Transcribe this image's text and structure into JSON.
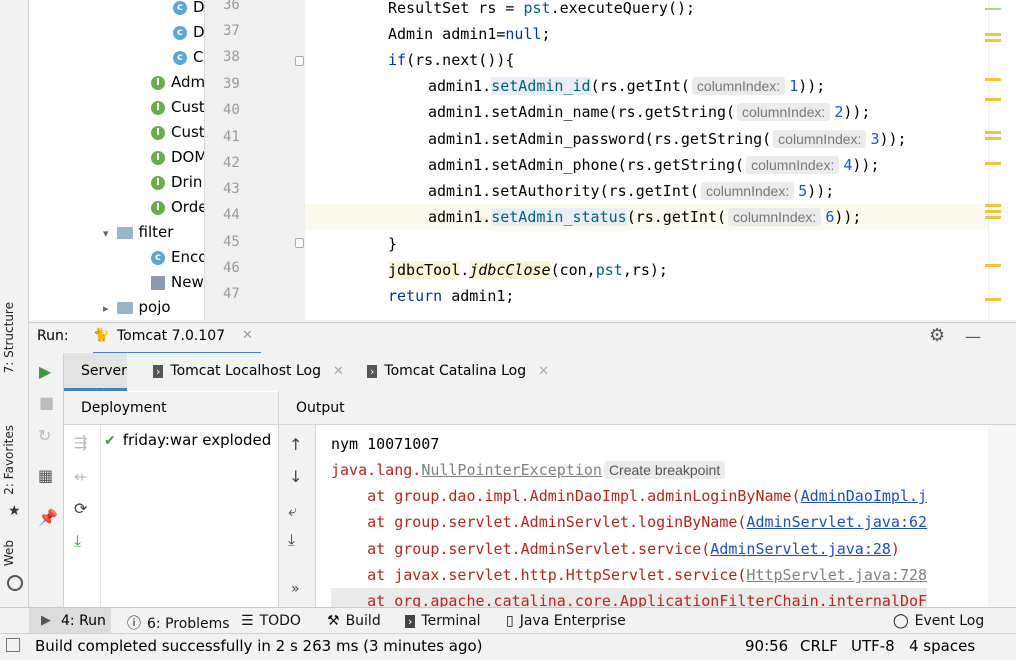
{
  "left_strip": {
    "structure": "7: Structure",
    "favorites": "2: Favorites",
    "web": "Web"
  },
  "tree": {
    "items": [
      "D",
      "D",
      "C",
      "Adm",
      "Cust",
      "Cust",
      "DOM",
      "Drin",
      "Orde",
      "filter",
      "Enco",
      "New",
      "pojo"
    ]
  },
  "editor": {
    "line_numbers": [
      "36",
      "37",
      "38",
      "39",
      "40",
      "41",
      "42",
      "43",
      "44",
      "45",
      "46",
      "47"
    ],
    "lines": {
      "l36_a": "ResultSet rs = ",
      "l36_b": "pst",
      "l36_c": ".executeQuery();",
      "l37_a": "Admin admin1=",
      "l37_b": "null",
      "l37_c": ";",
      "l38_a": "if",
      "l38_b": "(rs.next()){",
      "l39_a": "admin1.",
      "l39_b": "setAdmin_id",
      "l39_c": "(rs.getInt(",
      "l39_hint": "columnIndex:",
      "l39_num": "1",
      "l39_d": "));",
      "l40_a": "admin1.setAdmin_name(rs.getString(",
      "l40_hint": "columnIndex:",
      "l40_num": "2",
      "l40_d": "));",
      "l41_a": "admin1.setAdmin_password(rs.getString(",
      "l41_hint": "columnIndex:",
      "l41_num": "3",
      "l41_d": "));",
      "l42_a": "admin1.setAdmin_phone(rs.getString(",
      "l42_hint": "columnIndex:",
      "l42_num": "4",
      "l42_d": "));",
      "l43_a": "admin1.setAuthority(rs.getInt(",
      "l43_hint": "columnIndex:",
      "l43_num": "5",
      "l43_d": "));",
      "l44_a": "admin1.",
      "l44_b": "setAdmin_status",
      "l44_c": "(rs.getInt(",
      "l44_hint": "columnIndex:",
      "l44_num": "6",
      "l44_d": "));",
      "l45_a": "}",
      "l46_a": "jdbcTool",
      "l46_b": ".",
      "l46_c": "jdbcClose",
      "l46_d": "(con,",
      "l46_e": "pst",
      "l46_f": ",rs);",
      "l47_a": "return",
      "l47_b": " admin1;"
    }
  },
  "run": {
    "label": "Run:",
    "config": "Tomcat 7.0.107",
    "tabs": {
      "server": "Server",
      "localhost_log": "Tomcat Localhost Log",
      "catalina_log": "Tomcat Catalina Log"
    },
    "deployment_header": "Deployment",
    "deployment_item": "friday:war exploded",
    "output_header": "Output",
    "output": {
      "o1": "nym 10071007",
      "o2_a": "java.lang.",
      "o2_b": "NullPointerException",
      "o2_hint": "Create breakpoint",
      "o3_a": "    at group.dao.impl.AdminDaoImpl.adminLoginByName(",
      "o3_b": "AdminDaoImpl.j",
      "o4_a": "    at group.servlet.AdminServlet.loginByName(",
      "o4_b": "AdminServlet.java:62",
      "o5_a": "    at group.servlet.AdminServlet.service(",
      "o5_b": "AdminServlet.java:28",
      "o5_c": ")",
      "o6_a": "    at javax.servlet.http.HttpServlet.service(",
      "o6_b": "HttpServlet.java:728",
      "o7_a": "    at org.apache.catalina.core.ApplicationFilterChain.internalDoF"
    }
  },
  "bottom_tabs": {
    "run": "4: Run",
    "problems": "6: Problems",
    "todo": "TODO",
    "build": "Build",
    "terminal": "Terminal",
    "java_ee": "Java Enterprise",
    "event_log": "Event Log"
  },
  "status": {
    "message": "Build completed successfully in 2 s 263 ms (3 minutes ago)",
    "position": "90:56",
    "line_sep": "CRLF",
    "encoding": "UTF-8",
    "indent": "4 spaces"
  }
}
